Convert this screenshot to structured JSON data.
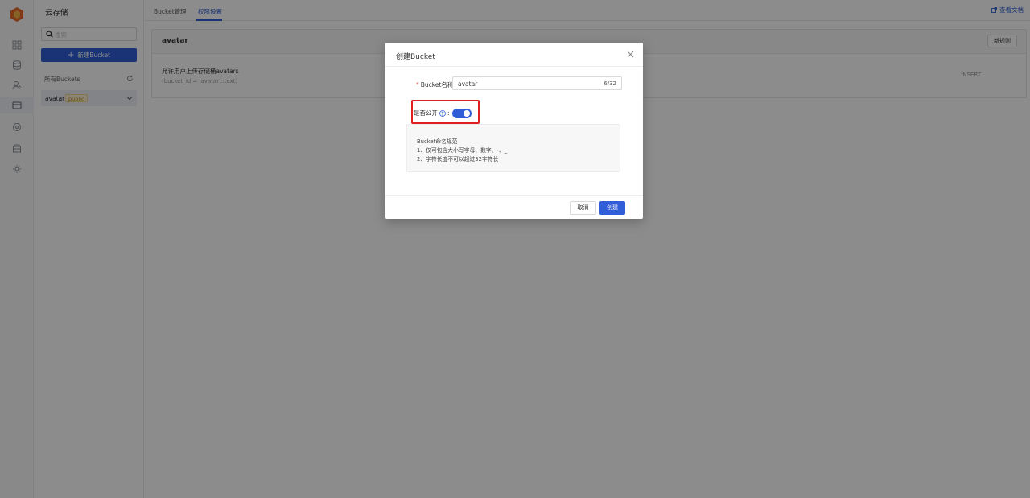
{
  "rail": {
    "icons": [
      "app-logo-icon",
      "dashboard-icon",
      "database-icon",
      "users-icon",
      "storage-icon",
      "api-icon",
      "functions-icon",
      "settings-icon"
    ],
    "accent": "#e8692b"
  },
  "sidebar": {
    "title": "云存储",
    "search_placeholder": "搜索",
    "new_bucket_label": "新建Bucket",
    "buckets_header": "所有Buckets",
    "buckets": [
      {
        "name": "avatar",
        "badge": "public"
      }
    ]
  },
  "main": {
    "tabs": [
      {
        "label": "Bucket管理",
        "active": false
      },
      {
        "label": "权限设置",
        "active": true
      }
    ],
    "doc_link": "查看文档",
    "panel_title": "avatar",
    "new_rule_label": "新规则",
    "rule": {
      "description": "允许用户上传存储桶avatars",
      "expression": "(bucket_id = 'avatar'::text)",
      "operation": "INSERT"
    }
  },
  "modal": {
    "title": "创建Bucket",
    "name_label": "Bucket名称:",
    "name_value": "avatar",
    "name_counter": "6/32",
    "public_label": "是否公开",
    "public_colon": ":",
    "public_on": true,
    "hint_title": "Bucket命名规范",
    "hint_line1": "1、仅可包含大小写字母、数字、-、_",
    "hint_line2": "2、字符长度不可以超过32字符长",
    "cancel_label": "取消",
    "create_label": "创建"
  },
  "colors": {
    "primary": "#2f5ed8",
    "highlight": "#e02020",
    "badge_bg": "#fff3d6"
  }
}
